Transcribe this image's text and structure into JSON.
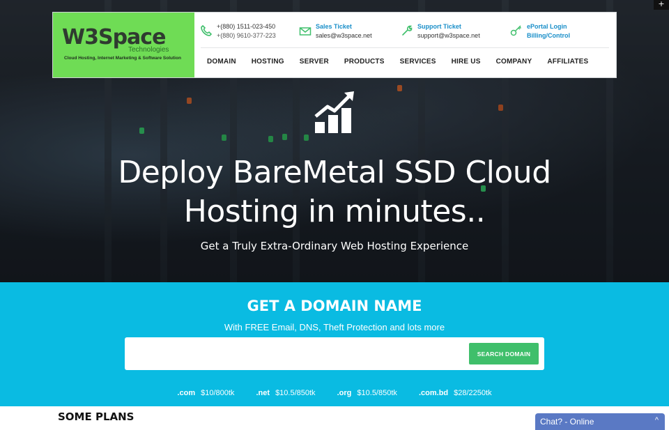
{
  "header": {
    "logo": {
      "name": "W3Space",
      "sub": "Technologies",
      "tagline": "Cloud Hosting, Internet Marketing & Software Solution"
    },
    "contacts": [
      {
        "icon": "phone-icon",
        "line1": "+(880) 1511-023-450",
        "line2": "+(880) 9610-377-223"
      },
      {
        "icon": "envelope-icon",
        "line1": "Sales Ticket",
        "line2": "sales@w3space.net"
      },
      {
        "icon": "wrench-icon",
        "line1": "Support Ticket",
        "line2": "support@w3space.net"
      },
      {
        "icon": "key-icon",
        "line1": "ePortal Login",
        "line2": "Billing/Control"
      }
    ],
    "nav": [
      "DOMAIN",
      "HOSTING",
      "SERVER",
      "PRODUCTS",
      "SERVICES",
      "HIRE US",
      "COMPANY",
      "AFFILIATES"
    ]
  },
  "hero": {
    "icon": "growth-chart-icon",
    "title_line1": "Deploy BareMetal SSD Cloud",
    "title_line2": "Hosting in minutes..",
    "subtitle": "Get a Truly Extra-Ordinary Web Hosting Experience"
  },
  "domain": {
    "title": "GET A DOMAIN NAME",
    "subtitle": "With FREE Email, DNS, Theft Protection and lots more",
    "input_value": "",
    "search_label": "SEARCH DOMAIN",
    "prices": [
      {
        "tld": ".com",
        "price": "$10/800tk"
      },
      {
        "tld": ".net",
        "price": "$10.5/850tk"
      },
      {
        "tld": ".org",
        "price": "$10.5/850tk"
      },
      {
        "tld": ".com.bd",
        "price": "$28/2250tk"
      }
    ]
  },
  "plans": {
    "title": "SOME PLANS"
  },
  "chat": {
    "label": "Chat? - Online",
    "caret": "^"
  },
  "corner": {
    "label": "+"
  },
  "colors": {
    "logo_bg": "#6fdc55",
    "band_bg": "#0abbe2",
    "search_btn": "#3fbf6b",
    "link_blue": "#1a8fc9",
    "chat_bg": "#5a79c4"
  }
}
